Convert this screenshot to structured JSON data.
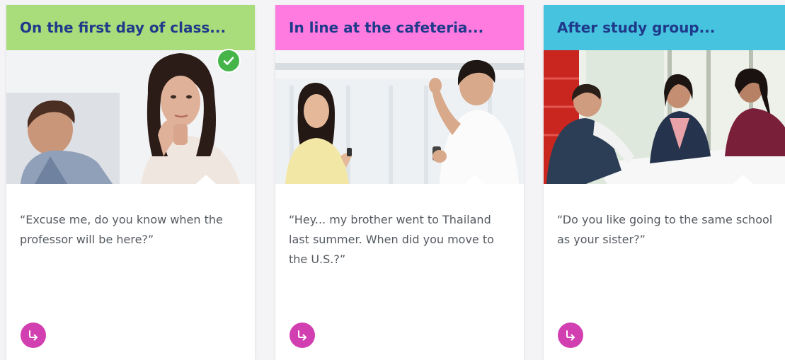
{
  "theme": {
    "header_green": "#a9dc7a",
    "header_pink": "#ff7be0",
    "header_cyan": "#45c3df",
    "title_color": "#1f3a8a",
    "action_color": "#d23fb0",
    "check_color": "#45b54a"
  },
  "cards": [
    {
      "title": "On the first day of class...",
      "quote": "“Excuse me, do you know when the professor will be here?”",
      "selected": true,
      "icons": [
        "check-icon",
        "arrow-return-icon"
      ]
    },
    {
      "title": "In line at the cafeteria...",
      "quote": "“Hey... my brother went to Thailand last summer. When did you move to the U.S.?”",
      "selected": false,
      "icons": [
        "arrow-return-icon"
      ]
    },
    {
      "title": "After study group...",
      "quote": "“Do you like going to the same school as your sister?”",
      "selected": false,
      "icons": [
        "arrow-return-icon"
      ]
    }
  ]
}
